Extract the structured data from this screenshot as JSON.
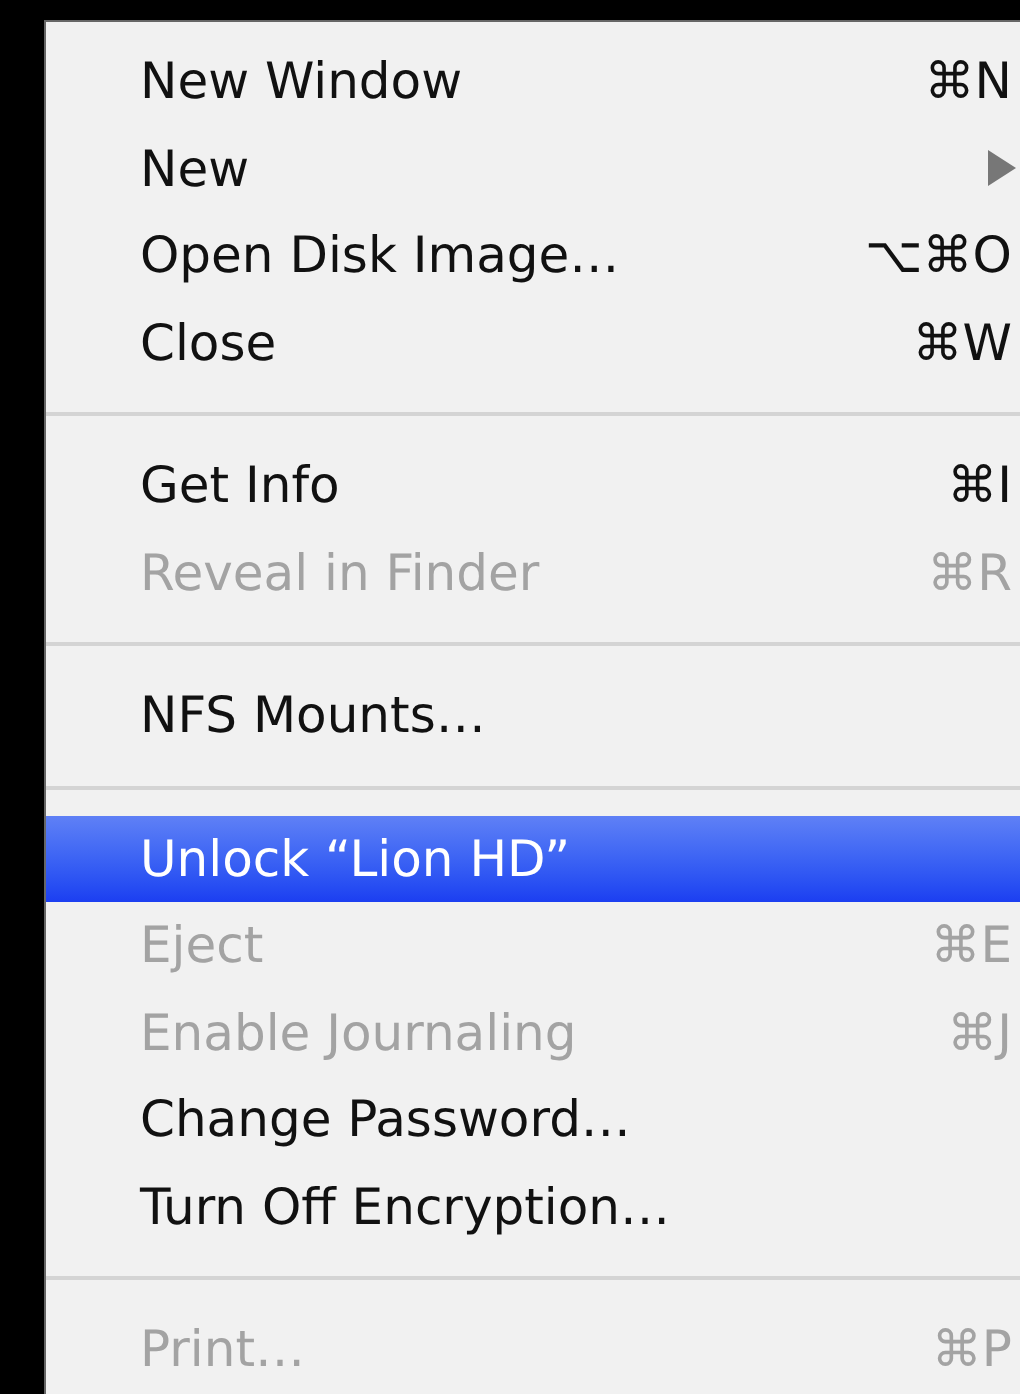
{
  "menu": {
    "sections": [
      {
        "items": [
          {
            "label": "New Window",
            "shortcut": "⌘N",
            "disabled": false,
            "selected": false,
            "kind": "command"
          },
          {
            "label": "New",
            "disabled": false,
            "selected": false,
            "kind": "submenu"
          },
          {
            "label": "Open Disk Image…",
            "shortcut": "⌥⌘O",
            "disabled": false,
            "selected": false,
            "kind": "command"
          },
          {
            "label": "Close",
            "shortcut": "⌘W",
            "disabled": false,
            "selected": false,
            "kind": "command"
          }
        ]
      },
      {
        "items": [
          {
            "label": "Get Info",
            "shortcut": "⌘I",
            "disabled": false,
            "selected": false,
            "kind": "command"
          },
          {
            "label": "Reveal in Finder",
            "shortcut": "⌘R",
            "disabled": true,
            "selected": false,
            "kind": "command"
          }
        ]
      },
      {
        "items": [
          {
            "label": "NFS Mounts…",
            "disabled": false,
            "selected": false,
            "kind": "command"
          }
        ]
      },
      {
        "items": [
          {
            "label": "Unlock “Lion HD”",
            "selected": true,
            "kind": "command"
          },
          {
            "label": "Eject",
            "shortcut": "⌘E",
            "disabled": true,
            "selected": false,
            "kind": "command"
          },
          {
            "label": "Enable Journaling",
            "shortcut": "⌘J",
            "disabled": true,
            "selected": false,
            "kind": "command"
          },
          {
            "label": "Change Password…",
            "disabled": false,
            "selected": false,
            "kind": "command"
          },
          {
            "label": "Turn Off Encryption…",
            "disabled": false,
            "selected": false,
            "kind": "command"
          }
        ]
      },
      {
        "items": [
          {
            "label": "Print…",
            "shortcut": "⌘P",
            "disabled": true,
            "selected": false,
            "kind": "command"
          }
        ]
      }
    ]
  }
}
